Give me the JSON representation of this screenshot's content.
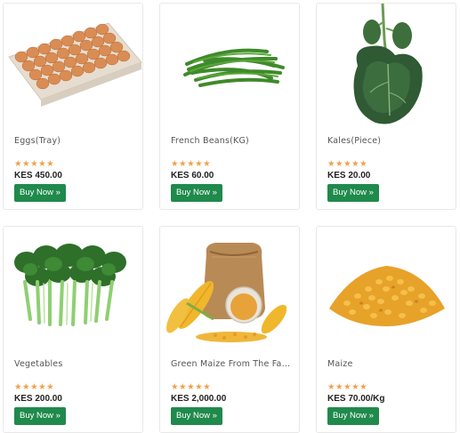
{
  "products": [
    {
      "name": "Eggs(Tray)",
      "price": "KES 450.00",
      "rating_stars": 5,
      "buy_label": "Buy Now »"
    },
    {
      "name": "French Beans(KG)",
      "price": "KES 60.00",
      "rating_stars": 5,
      "buy_label": "Buy Now »"
    },
    {
      "name": "Kales(Piece)",
      "price": "KES 20.00",
      "rating_stars": 5,
      "buy_label": "Buy Now »"
    },
    {
      "name": "Vegetables",
      "price": "KES 200.00",
      "rating_stars": 5,
      "buy_label": "Buy Now »"
    },
    {
      "name": "Green Maize From The Far...",
      "price": "KES 2,000.00",
      "rating_stars": 5,
      "buy_label": "Buy Now »"
    },
    {
      "name": "Maize",
      "price": "KES 70.00/Kg",
      "rating_stars": 5,
      "buy_label": "Buy Now »"
    }
  ],
  "colors": {
    "star": "#f0a04b",
    "button": "#1f8a4c"
  }
}
